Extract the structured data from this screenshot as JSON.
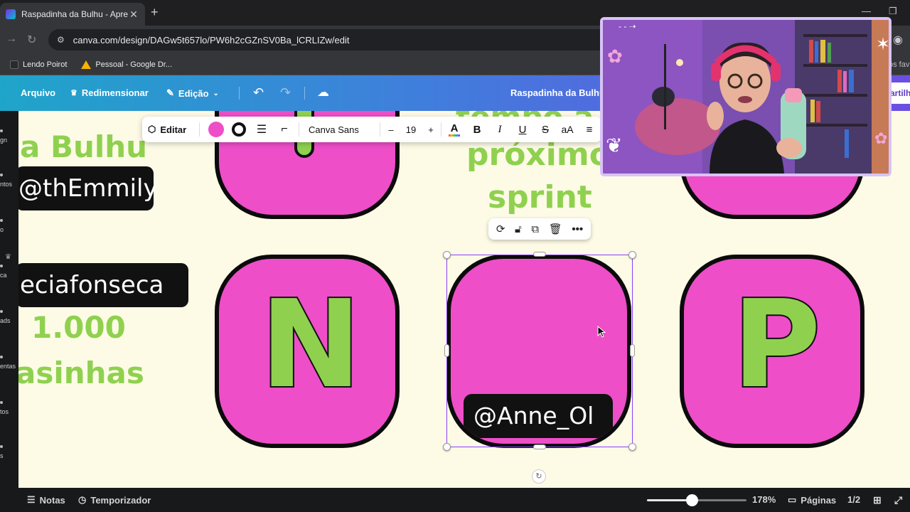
{
  "browser": {
    "tab_title": "Raspadinha da Bulhu - Apresen",
    "url": "canva.com/design/DAGw5t657lo/PW6h2cGZnSV0Ba_lCRLIZw/edit",
    "bookmarks": [
      {
        "label": "Lendo Poirot",
        "color": "#2a2a2a"
      },
      {
        "label": "Pessoal - Google Dr...",
        "color": "#f4b400"
      }
    ],
    "bookmark_overflow": "os fav"
  },
  "canva_header": {
    "file_label": "Arquivo",
    "resize_label": "Redimensionar",
    "edit_label": "Edição",
    "doc_title": "Raspadinha da Bulhu",
    "share_label": "artilh"
  },
  "sidebar": {
    "items": [
      "gn",
      "ntos",
      "o",
      "ca",
      "ads",
      "entas",
      "tos",
      "s"
    ]
  },
  "text_toolbar": {
    "edit_label": "Editar",
    "fill_color": "#ee4ec8",
    "font_name": "Canva Sans",
    "font_size": "19",
    "minus": "–",
    "plus": "+",
    "bold": "B",
    "italic": "I",
    "underline": "U",
    "strike": "S",
    "case": "aA"
  },
  "canvas": {
    "bg_color": "#fdfbe6",
    "tile_color": "#ee4ec8",
    "text_green": "#8fd14f",
    "left_title": "a Bulhu",
    "left_handle_1": "@thEmmily",
    "left_handle_2": "eciafonseca",
    "left_count": "1.000",
    "left_word": "asinhas",
    "right_line_1": "tempo a",
    "right_line_2": "próximo",
    "right_line_3": "sprint",
    "tiles": [
      {
        "letter": "N"
      },
      {
        "letter": ""
      },
      {
        "letter": "P"
      }
    ],
    "selected_tile_pill": "@Anne_Ol"
  },
  "footer": {
    "notes_label": "Notas",
    "timer_label": "Temporizador",
    "zoom_value": 0.45,
    "zoom_label": "178%",
    "pages_label": "Páginas",
    "page_count": "1/2"
  }
}
